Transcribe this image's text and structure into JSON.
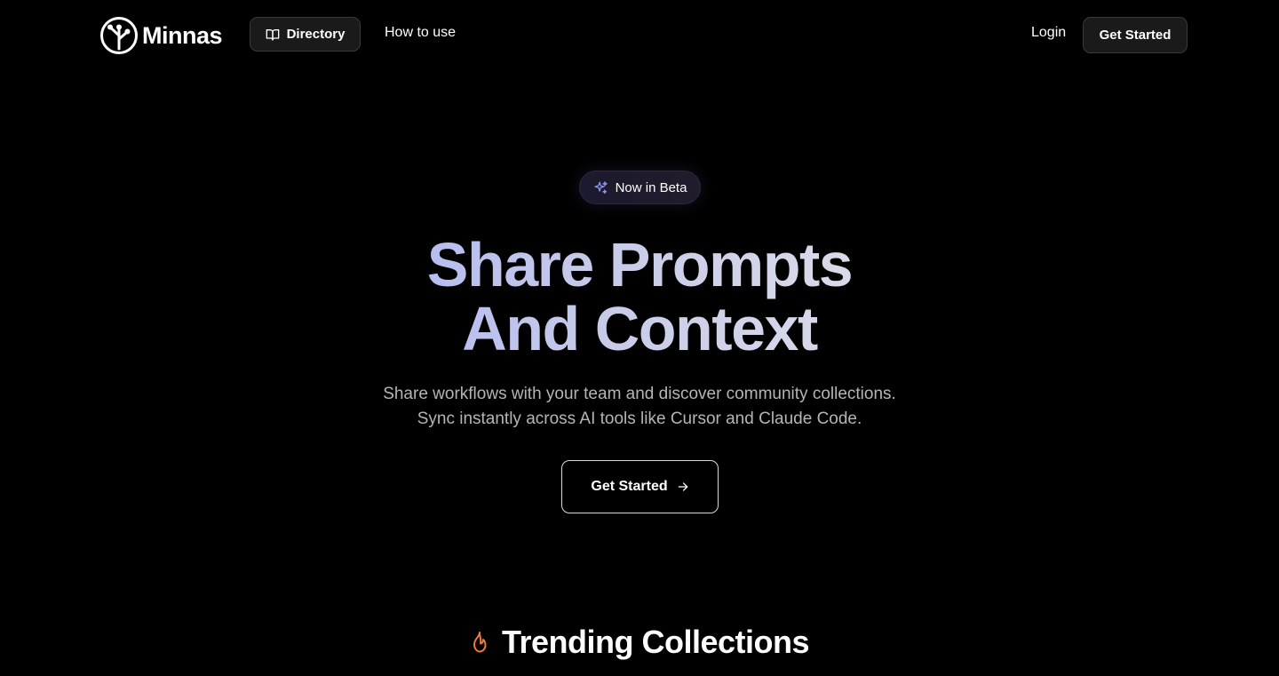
{
  "header": {
    "brand": "Minnas",
    "nav": {
      "directory_label": "Directory",
      "how_to_use_label": "How to use",
      "login_label": "Login",
      "get_started_label": "Get Started"
    }
  },
  "hero": {
    "badge": "Now in Beta",
    "title_line1": "Share Prompts",
    "title_line2": "And Context",
    "subtitle_line1": "Share workflows with your team and discover community collections.",
    "subtitle_line2": "Sync instantly across AI tools like Cursor and Claude Code.",
    "cta_label": "Get Started"
  },
  "trending": {
    "title": "Trending Collections"
  },
  "icons": {
    "logo": "tree-logo-icon",
    "directory": "book-open-icon",
    "badge": "sparkles-icon",
    "cta": "arrow-right-icon",
    "trending": "flame-icon"
  },
  "colors": {
    "background": "#000000",
    "title_gradient_start": "#aab2f5",
    "title_gradient_end": "#e3e3ea",
    "subtitle": "#b5b5b5",
    "flame": "#f07a3a",
    "sparkle": "#8b95f0"
  }
}
